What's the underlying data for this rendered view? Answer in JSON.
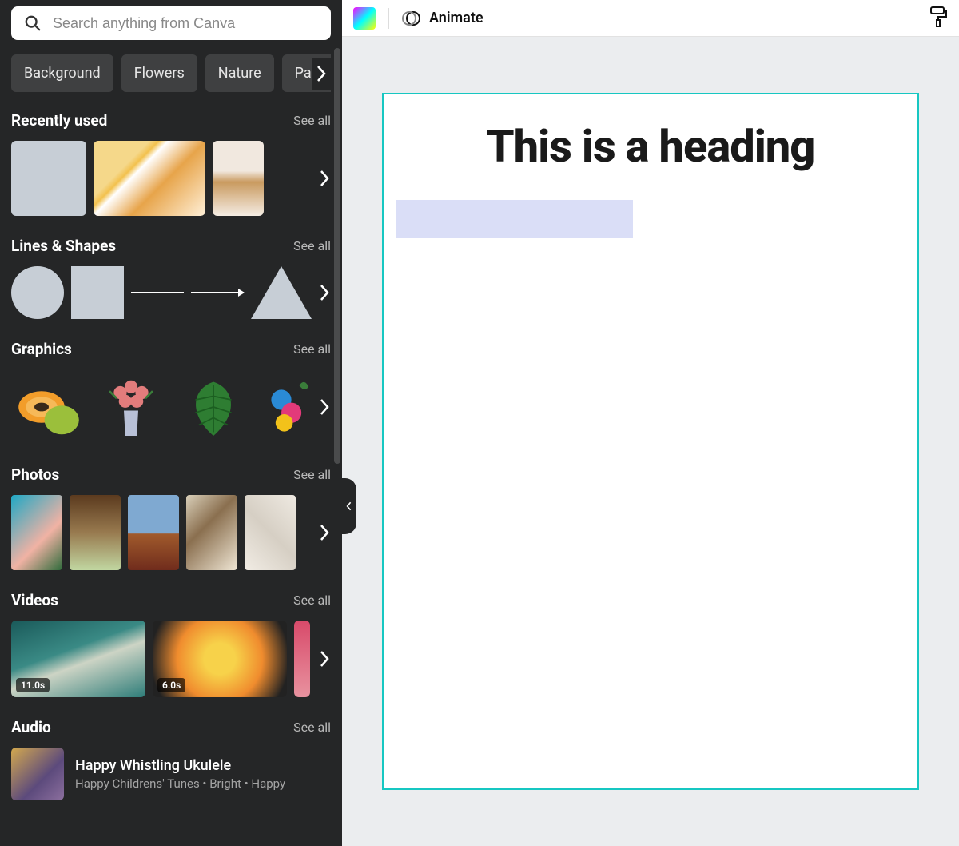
{
  "search": {
    "placeholder": "Search anything from Canva"
  },
  "chips": [
    "Background",
    "Flowers",
    "Nature",
    "Pastel b"
  ],
  "sections": {
    "recent": {
      "title": "Recently used",
      "see_all": "See all"
    },
    "lines": {
      "title": "Lines & Shapes",
      "see_all": "See all"
    },
    "graphics": {
      "title": "Graphics",
      "see_all": "See all"
    },
    "photos": {
      "title": "Photos",
      "see_all": "See all"
    },
    "videos": {
      "title": "Videos",
      "see_all": "See all"
    },
    "audio": {
      "title": "Audio",
      "see_all": "See all"
    }
  },
  "videos": {
    "v1_duration": "11.0s",
    "v2_duration": "6.0s"
  },
  "audio_item": {
    "title": "Happy Whistling Ukulele",
    "subtitle": "Happy Childrens' Tunes • Bright • Happy"
  },
  "toolbar": {
    "animate_label": "Animate"
  },
  "canvas": {
    "heading": "This is a heading"
  }
}
